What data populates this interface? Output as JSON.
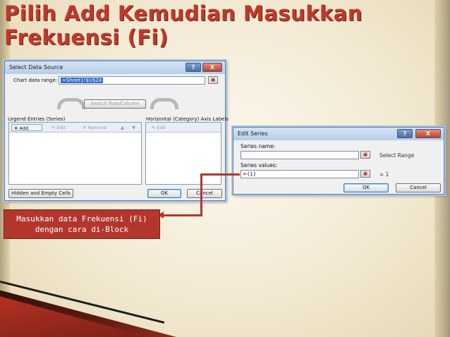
{
  "slide": {
    "title": "Pilih Add Kemudian Masukkan Frekuensi (Fi)",
    "callout": "Masukkan data Frekuensi (Fi) dengan cara di-Block"
  },
  "select_data_source": {
    "title": "Select Data Source",
    "help": "?",
    "close": "X",
    "chart_data_range_label": "Chart data range:",
    "chart_data_range_value": "=Sheet1!$U$24",
    "switch_row_column": "Switch Row/Column",
    "legend_entries_label": "Legend Entries (Series)",
    "add": "Add",
    "edit": "Edit",
    "remove": "Remove",
    "up": "▲",
    "down": "▼",
    "axis_labels_label": "Horizontal (Category) Axis Labels",
    "axis_edit": "Edit",
    "hidden_empty": "Hidden and Empty Cells",
    "ok": "OK",
    "cancel": "Cancel"
  },
  "edit_series": {
    "title": "Edit Series",
    "help": "?",
    "close": "X",
    "series_name_label": "Series name:",
    "series_name_value": "",
    "select_range": "Select Range",
    "series_values_label": "Series values:",
    "series_values_value": "={1}",
    "values_result": "= 1",
    "ok": "OK",
    "cancel": "Cancel"
  },
  "colors": {
    "title": "#c0392b",
    "callout": "#b3362d",
    "dialog_title_bar": "#b6cde8"
  }
}
